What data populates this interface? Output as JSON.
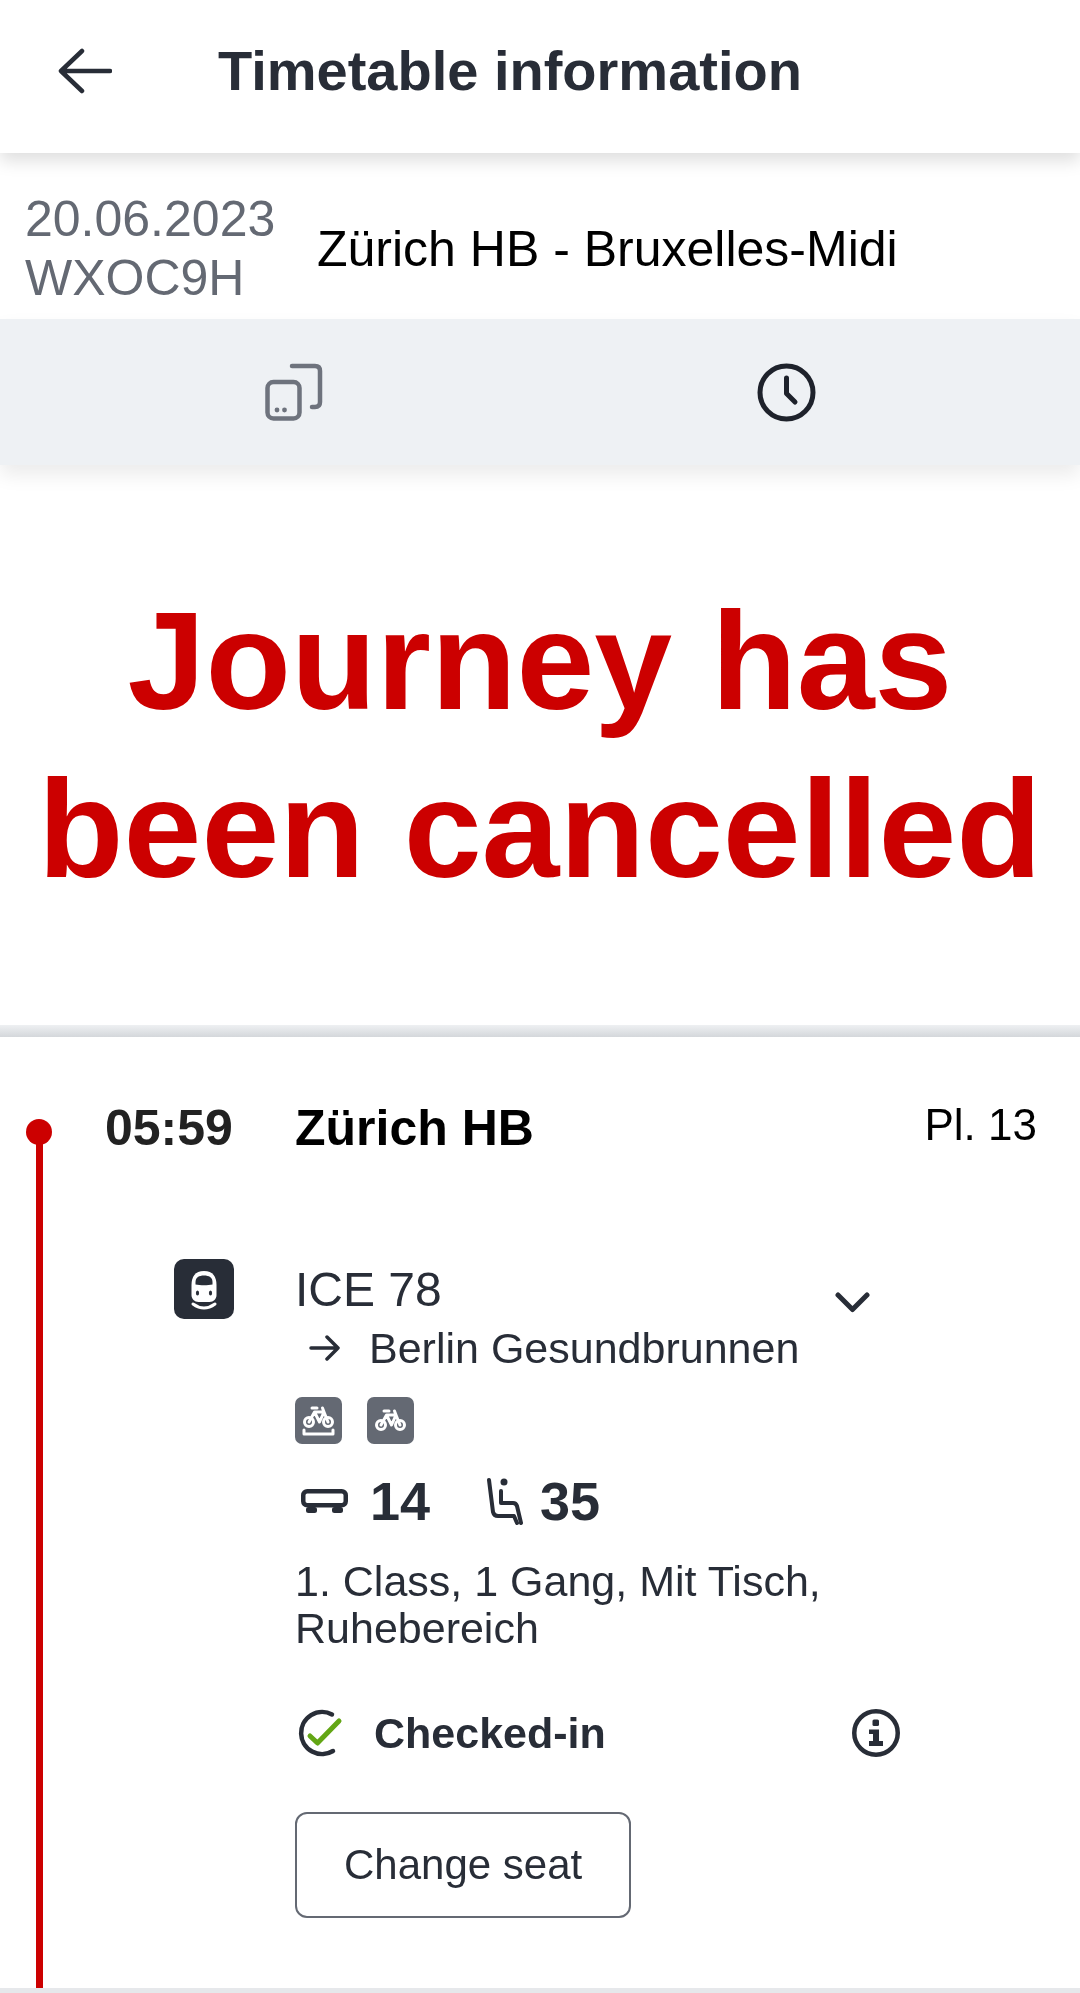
{
  "top_bar": {
    "title": "Timetable information"
  },
  "booking": {
    "date": "20.06.2023",
    "reference": "WXOC9H",
    "route": "Zürich HB - Bruxelles-Midi"
  },
  "tabs": [
    {
      "kind": "devices",
      "selected": false
    },
    {
      "kind": "clock",
      "selected": true
    }
  ],
  "notice": {
    "message": "Journey has been cancelled"
  },
  "itinerary": {
    "stops": [
      {
        "time": "05:59",
        "station": "Zürich HB",
        "platform": "Pl. 13"
      }
    ],
    "train": {
      "name": "ICE 78",
      "direction": "Berlin Gesundbrunnen",
      "expanded": false,
      "amenities": [
        {
          "kind": "bike_reservation"
        },
        {
          "kind": "bike"
        }
      ],
      "coach": "14",
      "seat": "35",
      "seat_details": "1. Class, 1 Gang, Mit Tisch, Ruhebereich",
      "checkin": {
        "label": "Checked-in",
        "checked": true
      },
      "action": "Change seat"
    }
  }
}
